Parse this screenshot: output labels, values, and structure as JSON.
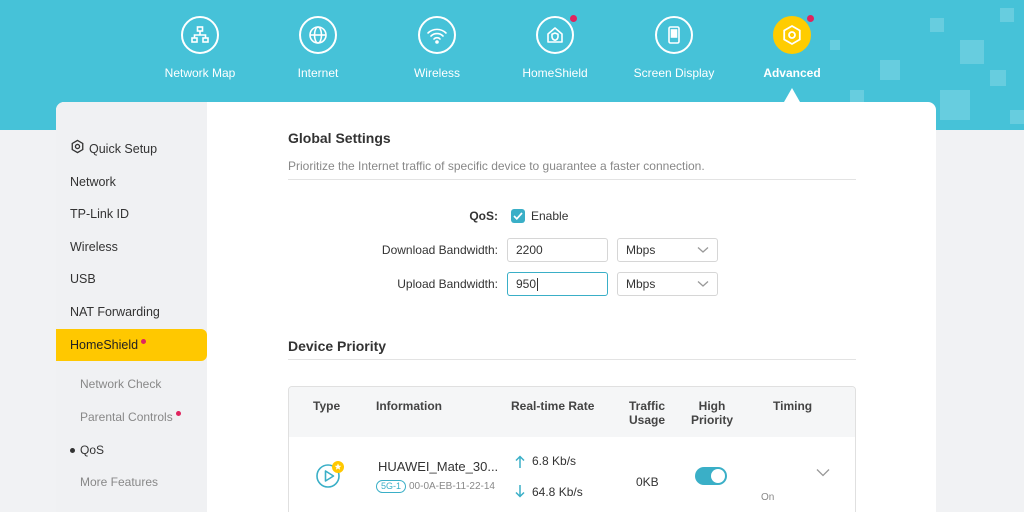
{
  "nav": {
    "items": [
      {
        "label": "Network Map",
        "icon": "network-map-icon"
      },
      {
        "label": "Internet",
        "icon": "globe-icon"
      },
      {
        "label": "Wireless",
        "icon": "wifi-icon"
      },
      {
        "label": "HomeShield",
        "icon": "home-shield-icon",
        "badge": true
      },
      {
        "label": "Screen Display",
        "icon": "screen-display-icon"
      },
      {
        "label": "Advanced",
        "icon": "gear-icon",
        "active": true,
        "badge": true
      }
    ]
  },
  "sidebar": {
    "items": [
      {
        "label": "Quick Setup",
        "icon": "gear-icon"
      },
      {
        "label": "Network"
      },
      {
        "label": "TP-Link ID"
      },
      {
        "label": "Wireless"
      },
      {
        "label": "USB"
      },
      {
        "label": "NAT Forwarding"
      },
      {
        "label": "HomeShield",
        "active": true,
        "badge": true
      }
    ],
    "subitems": [
      {
        "label": "Network Check"
      },
      {
        "label": "Parental Controls",
        "badge": true
      },
      {
        "label": "QoS",
        "current": true
      },
      {
        "label": "More Features"
      }
    ]
  },
  "global_settings": {
    "title": "Global Settings",
    "description": "Prioritize the Internet traffic of specific device to guarantee a faster connection.",
    "qos_label": "QoS:",
    "qos_enable_label": "Enable",
    "qos_enabled": true,
    "download_label": "Download Bandwidth:",
    "download_value": "2200",
    "download_unit": "Mbps",
    "upload_label": "Upload Bandwidth:",
    "upload_value": "950",
    "upload_unit": "Mbps"
  },
  "device_priority": {
    "title": "Device Priority",
    "columns": {
      "type": "Type",
      "information": "Information",
      "rate": "Real-time Rate",
      "traffic_line1": "Traffic",
      "traffic_line2": "Usage",
      "priority_line1": "High",
      "priority_line2": "Priority",
      "timing": "Timing"
    },
    "rows": [
      {
        "type_icon": "media-play-icon",
        "name": "HUAWEI_Mate_30...",
        "band": "5G-1",
        "mac": "00-0A-EB-11-22-14",
        "upload_rate": "6.8 Kb/s",
        "download_rate": "64.8 Kb/s",
        "traffic_usage": "0KB",
        "high_priority": true,
        "timing": "On"
      }
    ]
  },
  "colors": {
    "header_bg": "#46c2d8",
    "accent_yellow": "#ffc800",
    "accent_teal": "#3aafc7",
    "badge_red": "#e0245e"
  }
}
